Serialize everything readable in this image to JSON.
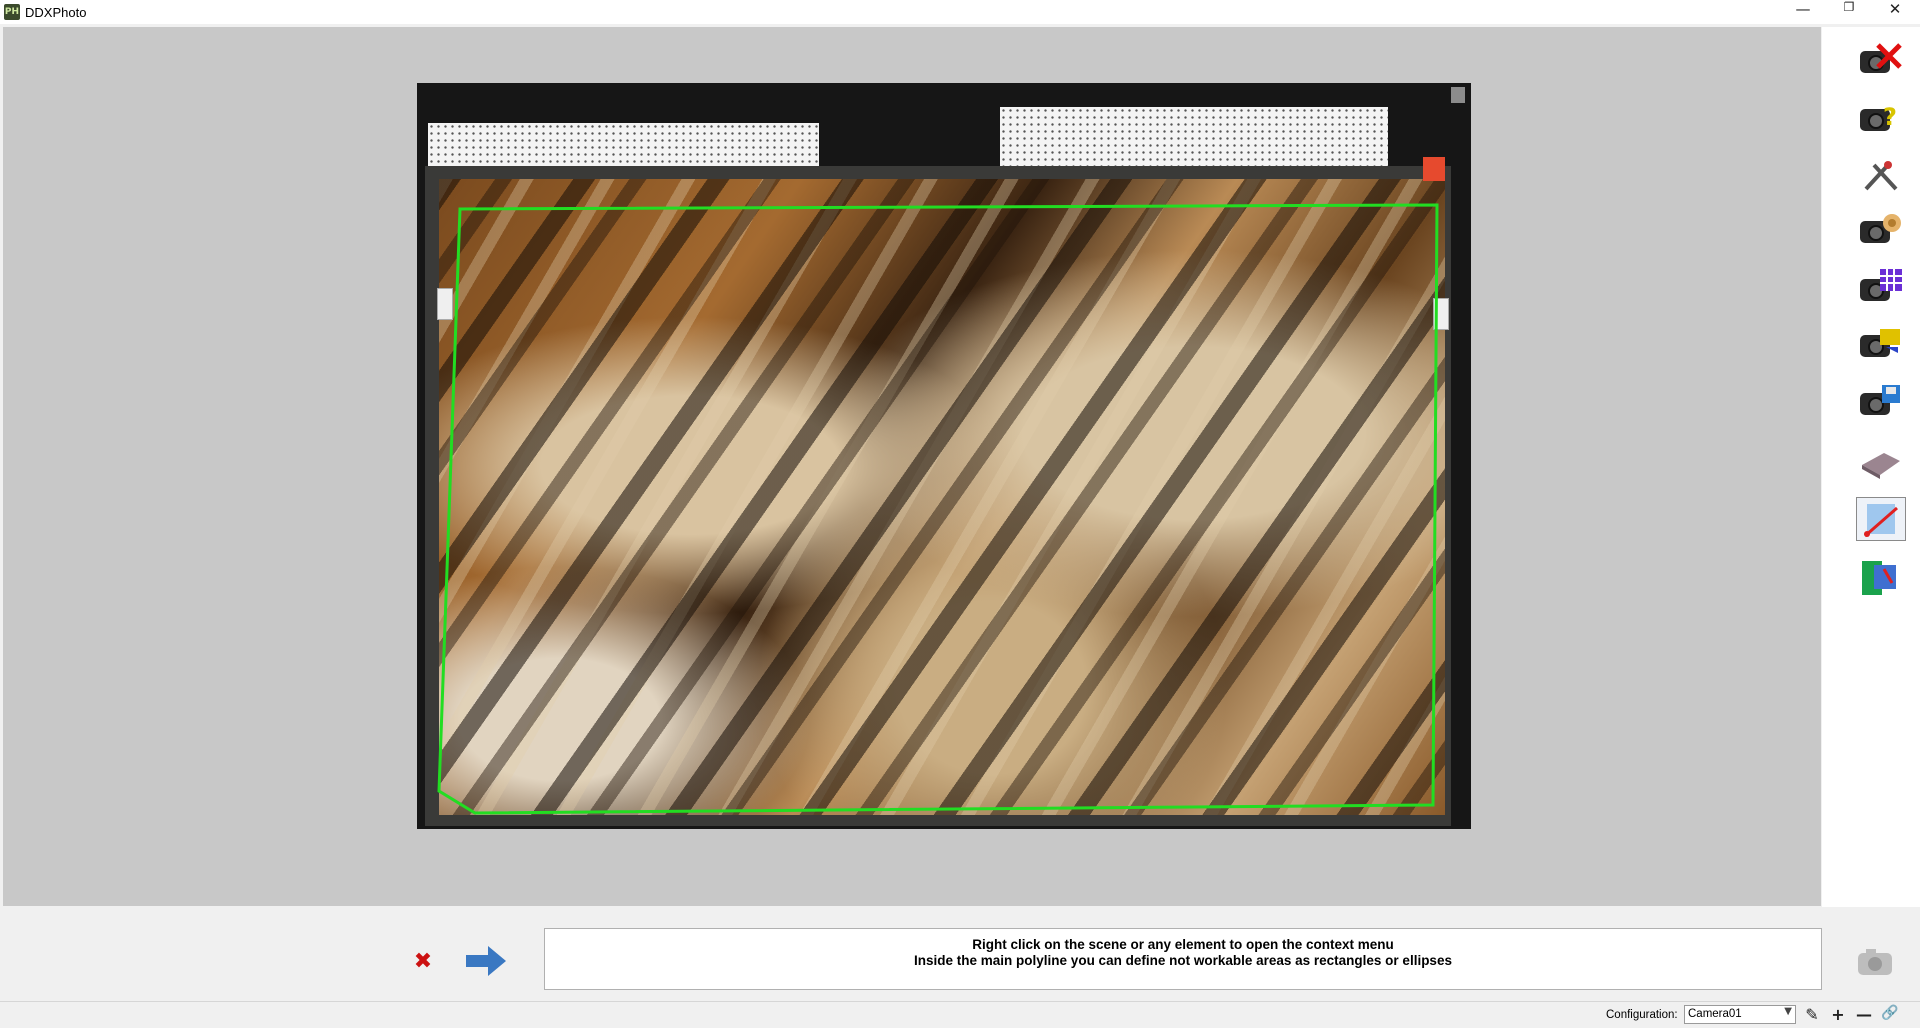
{
  "window": {
    "title": "DDXPhoto",
    "logo_text": "PH"
  },
  "message": {
    "line1": "Right click on the scene or any element to open the context menu",
    "line2": "Inside the main polyline you can define not workable areas as rectangles or ellipses"
  },
  "statusbar": {
    "config_label": "Configuration:",
    "config_value": "Camera01"
  },
  "toolbar": {
    "items": [
      "camera-delete-icon",
      "camera-help-icon",
      "tools-icon",
      "camera-settings-icon",
      "camera-grid-icon",
      "camera-folder-icon",
      "camera-save-icon",
      "slab-icon",
      "polyline-edit-icon",
      "area-edit-icon"
    ],
    "selected": "polyline-edit-icon"
  },
  "colors": {
    "outline": "#22dd22",
    "cancel": "#cc1111",
    "arrow": "#3a78c2"
  }
}
